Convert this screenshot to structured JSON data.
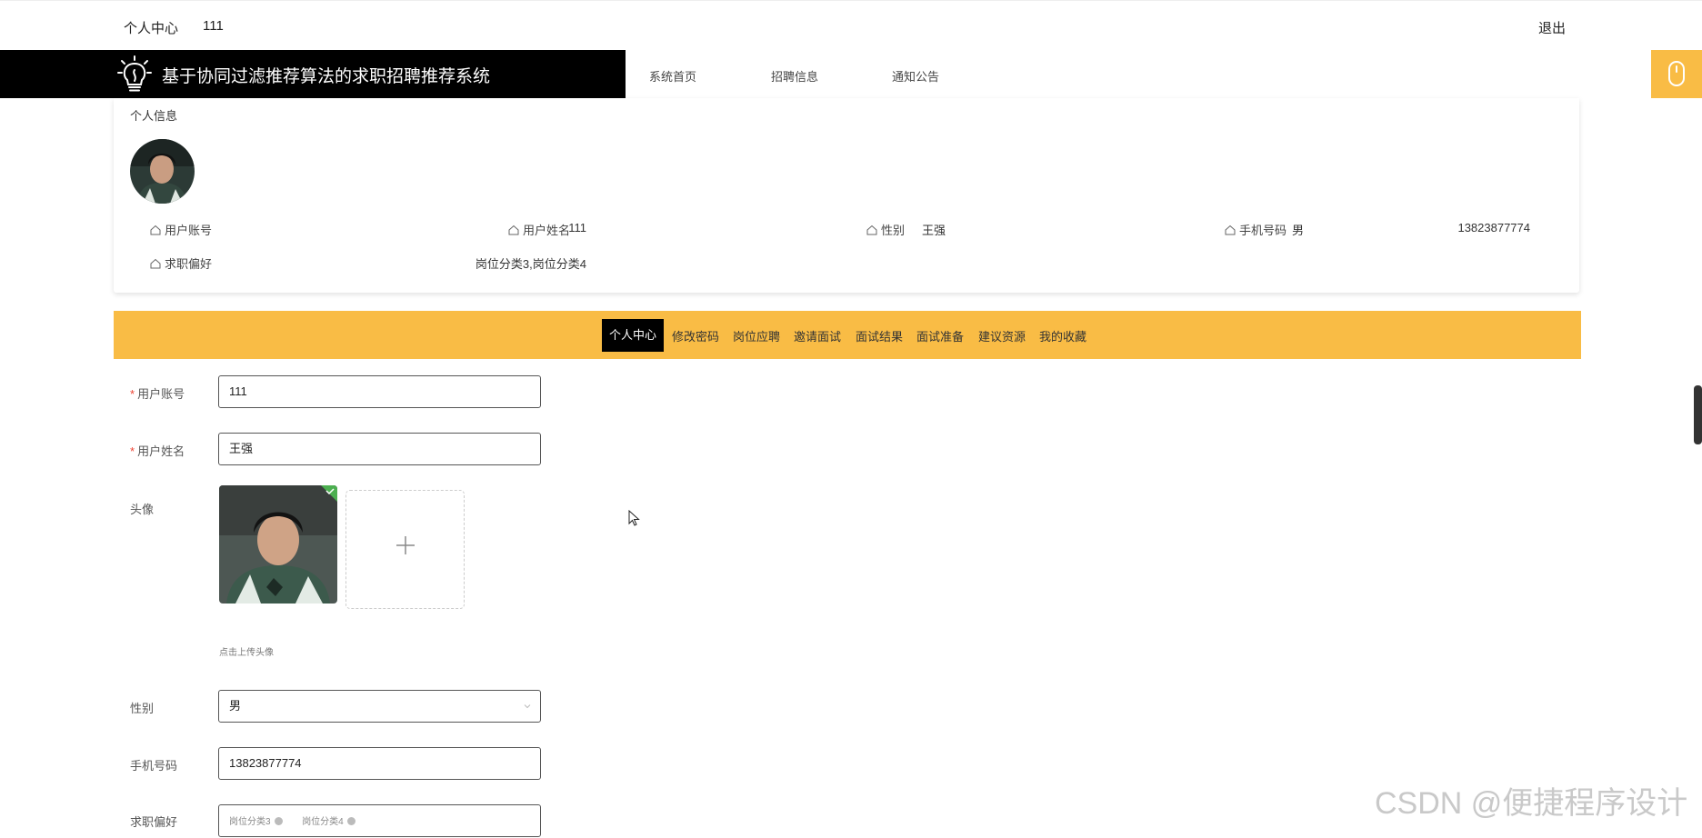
{
  "topbar": {
    "personal_center": "个人中心",
    "username": "111",
    "logout": "退出"
  },
  "header": {
    "title": "基于协同过滤推荐算法的求职招聘推荐系统",
    "nav": [
      "系统首页",
      "招聘信息",
      "通知公告"
    ]
  },
  "profile": {
    "heading": "个人信息",
    "fields": [
      {
        "label": "用户账号",
        "value": "111"
      },
      {
        "label": "用户姓名",
        "value": "王强"
      },
      {
        "label": "性别",
        "value": "男"
      },
      {
        "label": "手机号码",
        "value": "13823877774"
      },
      {
        "label": "求职偏好",
        "value": "岗位分类3,岗位分类4"
      }
    ]
  },
  "tabs": {
    "items": [
      "个人中心",
      "修改密码",
      "岗位应聘",
      "邀请面试",
      "面试结果",
      "面试准备",
      "建议资源",
      "我的收藏"
    ],
    "active": "个人中心"
  },
  "form": {
    "account": {
      "label": "用户账号",
      "value": "111"
    },
    "name": {
      "label": "用户姓名",
      "value": "王强"
    },
    "avatar": {
      "label": "头像",
      "hint": "点击上传头像"
    },
    "gender": {
      "label": "性别",
      "value": "男"
    },
    "phone": {
      "label": "手机号码",
      "value": "13823877774"
    },
    "preference": {
      "label": "求职偏好",
      "tags": [
        "岗位分类3",
        "岗位分类4"
      ]
    }
  },
  "watermark": "CSDN @便捷程序设计",
  "colors": {
    "accent": "#f9bc45",
    "header_bg": "#000000",
    "required": "#ee4433"
  }
}
